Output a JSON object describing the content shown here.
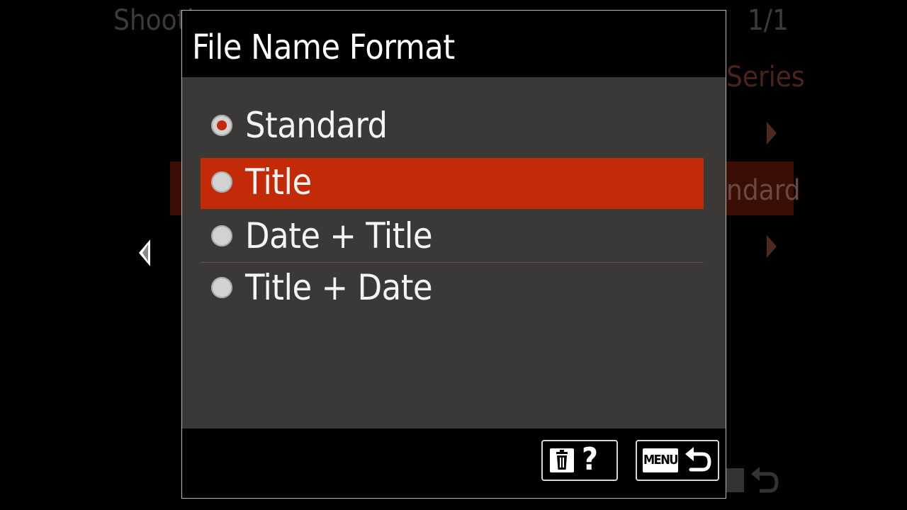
{
  "background": {
    "page_indicator": "1/1",
    "right_fragment_1": "Series",
    "right_fragment_2": "ndard",
    "left_fragment": "Shooti"
  },
  "dialog": {
    "title": "File Name Format",
    "options": [
      {
        "label": "Standard",
        "checked": true,
        "highlighted": false
      },
      {
        "label": "Title",
        "checked": false,
        "highlighted": true
      },
      {
        "label": "Date + Title",
        "checked": false,
        "highlighted": false
      },
      {
        "label": "Title + Date",
        "checked": false,
        "highlighted": false
      }
    ]
  },
  "footer": {
    "help_symbol": "?",
    "menu_key_label": "MENU"
  },
  "colors": {
    "accent": "#c22a08",
    "panel": "#3b3938",
    "background": "#000000"
  },
  "icons": {
    "delete_help": "trash-icon",
    "back": "back-arrow-icon",
    "page_left": "arrow-left-icon"
  }
}
